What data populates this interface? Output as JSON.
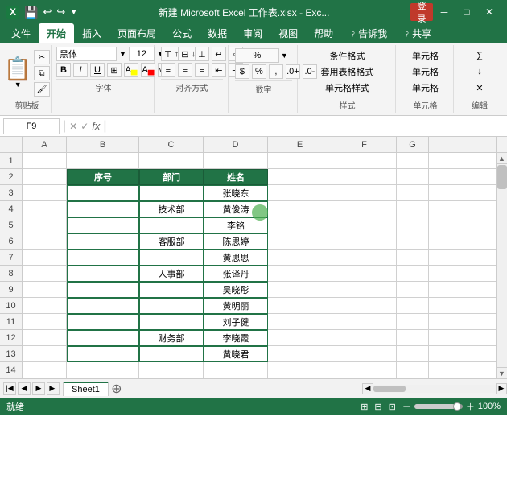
{
  "titleBar": {
    "title": "新建 Microsoft Excel 工作表.xlsx - Exc...",
    "saveIcon": "💾",
    "undoIcon": "↩",
    "redoIcon": "↪",
    "loginBtn": "登录",
    "minIcon": "－",
    "maxIcon": "□",
    "closeIcon": "✕"
  },
  "ribbonTabs": [
    "文件",
    "开始",
    "插入",
    "页面布局",
    "公式",
    "数据",
    "审阅",
    "视图",
    "帮助",
    "♀ 告诉我",
    "♀ 共享"
  ],
  "activeTab": "开始",
  "ribbon": {
    "paste": "粘贴",
    "clipboard": "剪贴板",
    "fontName": "黑体",
    "fontSize": "12",
    "bold": "B",
    "italic": "I",
    "underline": "U",
    "fontGroup": "字体",
    "alignGroup": "对齐方式",
    "numberGroup": "数字",
    "stylesGroup": "样式",
    "cellsGroup": "单元格",
    "editGroup": "编辑",
    "conditionalFormat": "条件格式",
    "tableFormat": "套用表格格式",
    "cellStyles": "单元格样式",
    "cellUnit": "单元格",
    "edit": "编辑"
  },
  "formulaBar": {
    "nameBox": "F9",
    "cancelIcon": "✕",
    "confirmIcon": "✓",
    "fxIcon": "fx",
    "formula": ""
  },
  "columns": [
    "A",
    "B",
    "C",
    "D",
    "E",
    "F",
    "G"
  ],
  "rows": [
    "1",
    "2",
    "3",
    "4",
    "5",
    "6",
    "7",
    "8",
    "9",
    "10",
    "11",
    "12",
    "13",
    "14"
  ],
  "tableData": {
    "headers": [
      "序号",
      "部门",
      "姓名"
    ],
    "headerRow": 2,
    "colB": 2,
    "colC": 3,
    "colD": 4,
    "departments": [
      {
        "name": "技术部",
        "startRow": 3,
        "rowCount": 3
      },
      {
        "name": "客服部",
        "startRow": 6,
        "rowCount": 2
      },
      {
        "name": "人事部",
        "startRow": 8,
        "rowCount": 4
      },
      {
        "name": "财务部",
        "startRow": 12,
        "rowCount": 2
      }
    ],
    "names": [
      "张晓东",
      "黄俊涛",
      "李铭",
      "陈思婷",
      "黄思思",
      "张译丹",
      "吴晓彤",
      "黄明丽",
      "刘子健",
      "李晓霞",
      "黄晓君"
    ],
    "nameRows": [
      3,
      4,
      5,
      6,
      7,
      8,
      9,
      10,
      11,
      12,
      13
    ]
  },
  "sheets": [
    "Sheet1"
  ],
  "statusBar": {
    "status": "就绪",
    "pageIcon": "⊞",
    "layoutIcon": "⊟",
    "previewIcon": "⊡",
    "zoom": "100%",
    "zoomSlider": 100
  }
}
